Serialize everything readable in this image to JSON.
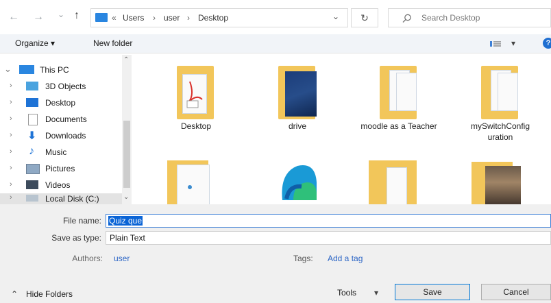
{
  "nav": {
    "back": "←",
    "forward": "→",
    "recent": "⌄",
    "up": "↑"
  },
  "address": {
    "overflow": "«",
    "crumbs": [
      "Users",
      "user",
      "Desktop"
    ],
    "separator": "›",
    "dropdown": "⌄",
    "refresh": "↻"
  },
  "search": {
    "placeholder": "Search Desktop"
  },
  "toolbar": {
    "organize": "Organize ▾",
    "new_folder": "New folder",
    "view": "▾",
    "help": "?"
  },
  "sidebar": {
    "items": [
      {
        "label": "This PC"
      },
      {
        "label": "3D Objects"
      },
      {
        "label": "Desktop"
      },
      {
        "label": "Documents"
      },
      {
        "label": "Downloads"
      },
      {
        "label": "Music"
      },
      {
        "label": "Pictures"
      },
      {
        "label": "Videos"
      },
      {
        "label": "Local Disk (C:)"
      }
    ]
  },
  "files": [
    {
      "name": "Desktop"
    },
    {
      "name": "drive"
    },
    {
      "name": "moodle as a Teacher"
    },
    {
      "name": "mySwitchConfig uration"
    }
  ],
  "form": {
    "filename_label": "File name:",
    "filename_value": "Quiz que",
    "saveas_label": "Save as type:",
    "saveas_value": "Plain Text",
    "authors_label": "Authors:",
    "authors_value": "user",
    "tags_label": "Tags:",
    "tags_value": "Add a tag"
  },
  "footer": {
    "hide_folders": "Hide Folders",
    "tools": "Tools",
    "tools_caret": "▾",
    "save": "Save",
    "cancel": "Cancel"
  },
  "colors": {
    "accent": "#3c7fd6",
    "link": "#2a64c5",
    "folder": "#f8d775",
    "toolbar_bg": "#f1f4f8",
    "form_bg": "#f0f0f0"
  }
}
